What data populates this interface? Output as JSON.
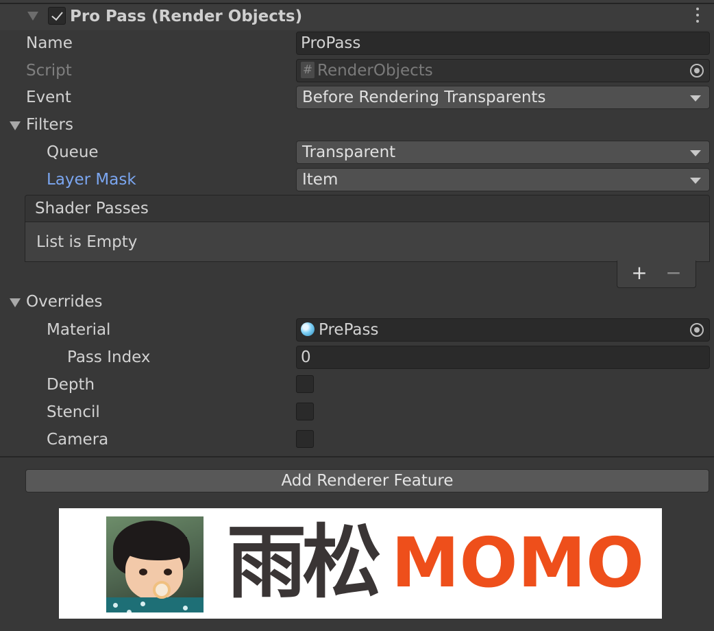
{
  "header": {
    "title": "Pro Pass (Render Objects)",
    "enabled": true
  },
  "fields": {
    "name": {
      "label": "Name",
      "value": "ProPass"
    },
    "script": {
      "label": "Script",
      "value": "RenderObjects",
      "icon": "script-hash-icon"
    },
    "event": {
      "label": "Event",
      "value": "Before Rendering Transparents"
    }
  },
  "filters": {
    "label": "Filters",
    "queue": {
      "label": "Queue",
      "value": "Transparent"
    },
    "layer_mask": {
      "label": "Layer Mask",
      "value": "Item"
    }
  },
  "shader_passes": {
    "header": "Shader Passes",
    "empty_text": "List is Empty",
    "add_label": "+",
    "remove_label": "−"
  },
  "overrides": {
    "label": "Overrides",
    "material": {
      "label": "Material",
      "value": "PrePass",
      "icon": "material-sphere-icon"
    },
    "pass_index": {
      "label": "Pass Index",
      "value": "0"
    },
    "depth": {
      "label": "Depth",
      "checked": false
    },
    "stencil": {
      "label": "Stencil",
      "checked": false
    },
    "camera": {
      "label": "Camera",
      "checked": false
    }
  },
  "add_feature_button": "Add Renderer Feature",
  "banner": {
    "text_cn": "雨松",
    "text_en": "MOMO",
    "colors": {
      "cn": "#3a3535",
      "en": "#ee4f1b"
    }
  },
  "colors": {
    "background": "#383838",
    "link_label": "#7ba6f0",
    "field": "#2a2a2a",
    "dropdown": "#505050"
  }
}
